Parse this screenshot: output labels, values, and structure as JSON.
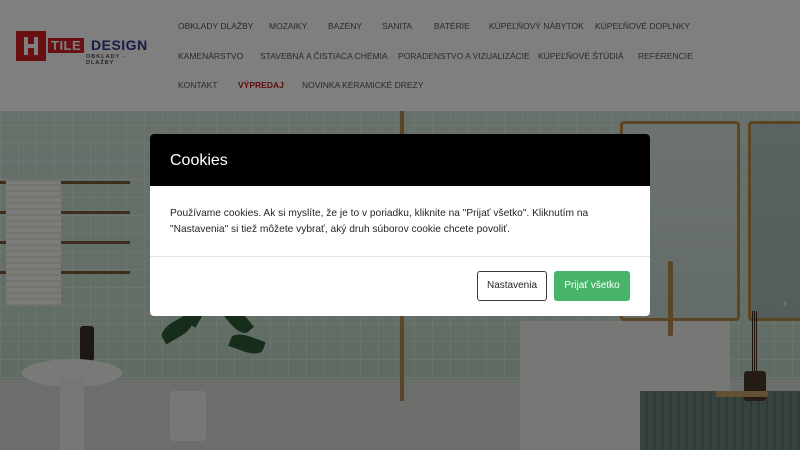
{
  "logo": {
    "brand_tile": "TILE",
    "brand_design": "DESIGN",
    "tagline": "OBKLADY - DLAŽBY"
  },
  "nav": {
    "row1": [
      "OBKLADY DLAŽBY",
      "MOZAIKY",
      "BAZÉNY",
      "SANITA",
      "BATÉRIE",
      "KÚPEĽŇOVÝ NÁBYTOK",
      "KÚPEĽŇOVÉ DOPLNKY"
    ],
    "row2": [
      "KAMENÁRSTVO",
      "STAVEBNÁ A ČISTIACA CHÉMIA",
      "PORADENSTVO A VIZUALIZÁCIE",
      "KÚPEĽŇOVÉ ŠTÚDIÁ",
      "REFERENCIE"
    ],
    "row3": [
      "KONTAKT",
      "VÝPREDAJ",
      "NOVINKA KERAMICKÉ DREZY"
    ]
  },
  "hero": {
    "next_icon": "chevron-right-icon",
    "next_glyph": "›"
  },
  "cookies": {
    "title": "Cookies",
    "text": "Používame cookies. Ak si myslíte, že je to v poriadku, kliknite na \"Prijať všetko\". Kliknutím na \"Nastavenia\" si tiež môžete vybrať, aký druh súborov cookie chcete povoliť.",
    "settings_label": "Nastavenia",
    "accept_label": "Prijať všetko"
  },
  "colors": {
    "brand_red": "#d32027",
    "brand_blue": "#2d3a8c",
    "accept_green": "#48b46a",
    "sale_red": "#c21a1a",
    "modal_header": "#000000"
  }
}
